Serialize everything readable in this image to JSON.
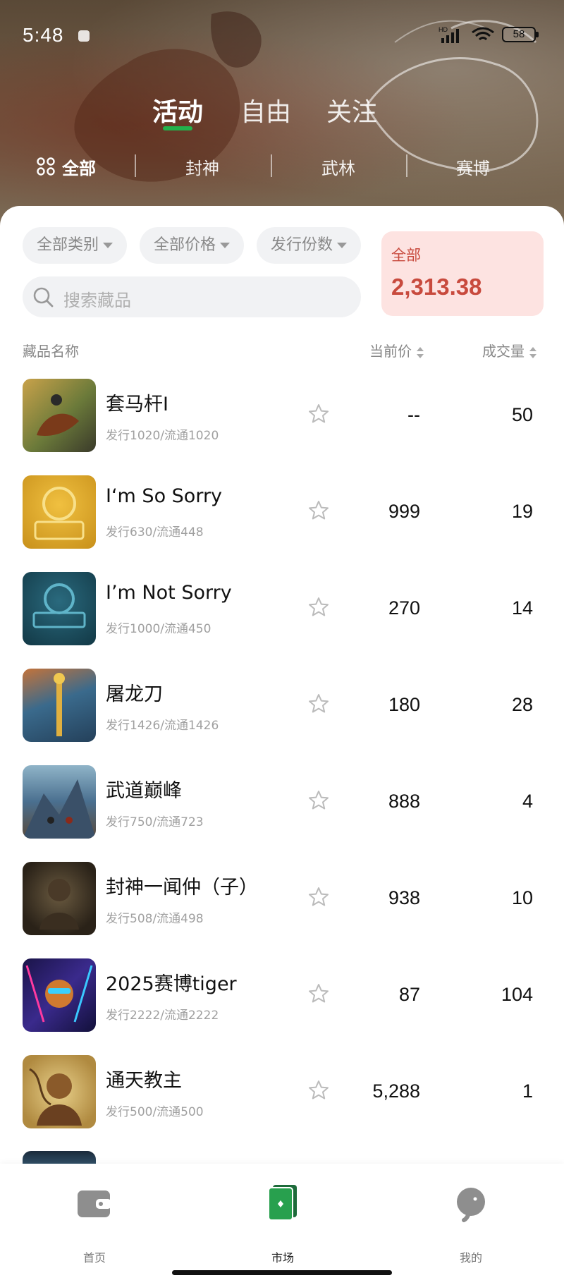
{
  "status_bar": {
    "time": "5:48",
    "network": "HD",
    "battery": "58"
  },
  "main_tabs": [
    {
      "label": "活动",
      "active": true
    },
    {
      "label": "自由",
      "active": false
    },
    {
      "label": "关注",
      "active": false
    }
  ],
  "sub_tabs": [
    {
      "label": "全部",
      "active": true
    },
    {
      "label": "封神",
      "active": false
    },
    {
      "label": "武林",
      "active": false
    },
    {
      "label": "赛博",
      "active": false
    }
  ],
  "filters": {
    "category": "全部类别",
    "price": "全部价格",
    "issue": "发行份数"
  },
  "search": {
    "placeholder": "搜索藏品"
  },
  "summary": {
    "label": "全部",
    "value": "2,313.38"
  },
  "columns": {
    "name": "藏品名称",
    "price": "当前价",
    "volume": "成交量"
  },
  "items": [
    {
      "name": "套马杆I",
      "sub": "发行1020/流通1020",
      "price": "--",
      "volume": "50",
      "thumb_color": "#6b7a3a"
    },
    {
      "name": "I‘m So Sorry",
      "sub": "发行630/流通448",
      "price": "999",
      "volume": "19",
      "thumb_color": "#d4a22b"
    },
    {
      "name": "I’m Not Sorry",
      "sub": "发行1000/流通450",
      "price": "270",
      "volume": "14",
      "thumb_color": "#1c4a5a"
    },
    {
      "name": "屠龙刀",
      "sub": "发行1426/流通1426",
      "price": "180",
      "volume": "28",
      "thumb_color": "#3a6a8c"
    },
    {
      "name": "武道巅峰",
      "sub": "发行750/流通723",
      "price": "888",
      "volume": "4",
      "thumb_color": "#4a6f8f"
    },
    {
      "name": "封神一闻仲（子）",
      "sub": "发行508/流通498",
      "price": "938",
      "volume": "10",
      "thumb_color": "#3b3328"
    },
    {
      "name": "2025赛博tiger",
      "sub": "发行2222/流通2222",
      "price": "87",
      "volume": "104",
      "thumb_color": "#2a1f5c"
    },
    {
      "name": "通天教主",
      "sub": "发行500/流通500",
      "price": "5,288",
      "volume": "1",
      "thumb_color": "#c9a55a"
    }
  ],
  "bottom_nav": [
    {
      "label": "首页",
      "icon": "wallet-icon",
      "active": false
    },
    {
      "label": "市场",
      "icon": "market-card-icon",
      "active": true
    },
    {
      "label": "我的",
      "icon": "elephant-icon",
      "active": false
    }
  ],
  "colors": {
    "accent": "#22b24c",
    "summary_text": "#c84a3d",
    "summary_bg": "#fde3e1"
  }
}
